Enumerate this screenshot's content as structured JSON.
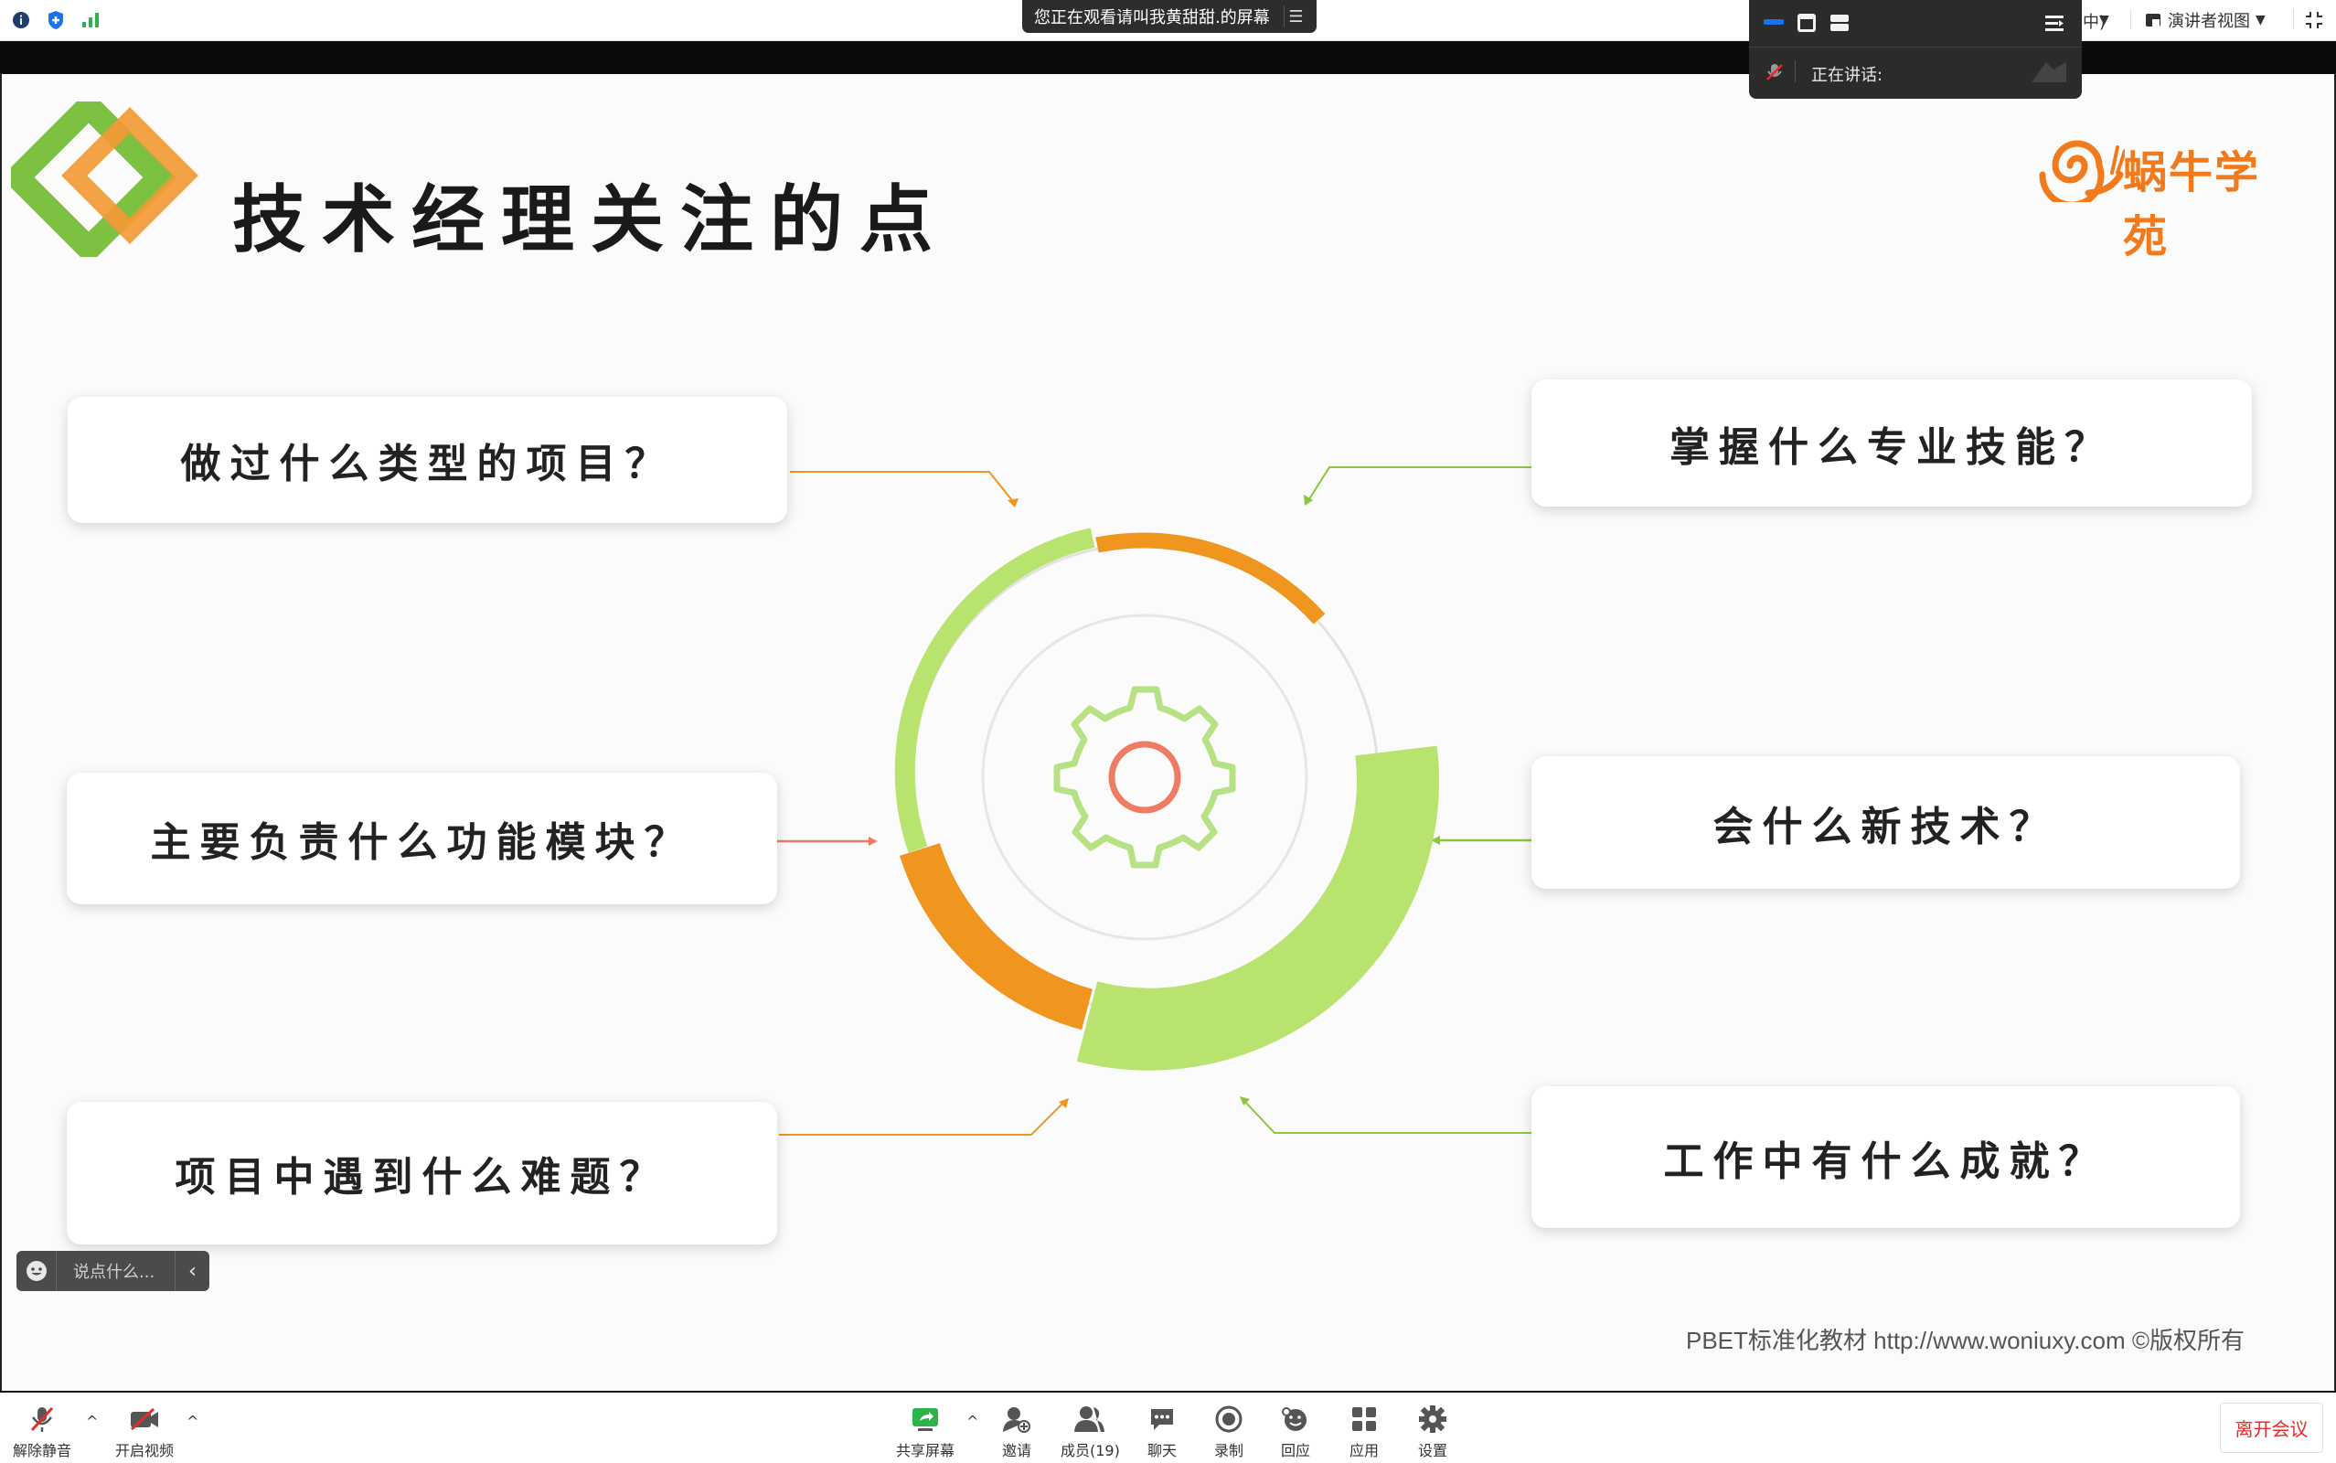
{
  "topbar": {
    "banner_text": "您正在观看请叫我黄甜甜.的屏幕",
    "menu_icon": "hamburger-icon",
    "right_partial": "中)",
    "presenter_view_label": "演讲者视图",
    "icons": [
      "info-icon",
      "shield-icon",
      "signal-icon",
      "fullscreen-exit-icon"
    ]
  },
  "speaker_panel": {
    "talking_label": "正在讲话:"
  },
  "slide": {
    "title": "技术经理关注的点",
    "brand": "蜗牛学苑",
    "questions": {
      "q1": "做过什么类型的项目？",
      "q2": "主要负责什么功能模块？",
      "q3": "项目中遇到什么难题？",
      "q4": "掌握什么专业技能？",
      "q5": "会什么新技术？",
      "q6": "工作中有什么成就？"
    },
    "footer": "PBET标准化教材   http://www.woniuxy.com ©版权所有",
    "colors": {
      "green": "#b8e36e",
      "orange": "#f0951e",
      "title_green": "#7cc142",
      "title_orange": "#f39a36",
      "gear_green": "#b6e283",
      "gear_red": "#ee7b62"
    }
  },
  "chat_input": {
    "placeholder": "说点什么..."
  },
  "toolbar": {
    "unmute": "解除静音",
    "start_video": "开启视频",
    "share_screen": "共享屏幕",
    "invite": "邀请",
    "members": "成员(19)",
    "chat": "聊天",
    "record": "录制",
    "reactions": "回应",
    "apps": "应用",
    "settings": "设置",
    "leave": "离开会议"
  }
}
